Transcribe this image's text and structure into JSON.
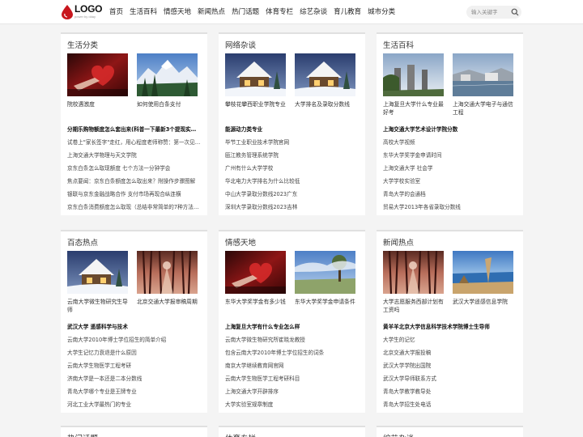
{
  "logo": {
    "text": "LOGO",
    "sub": "power by dday"
  },
  "nav": [
    "首页",
    "生活百科",
    "情感天地",
    "新闻热点",
    "热门话题",
    "体育专栏",
    "综艺杂谈",
    "育儿教育",
    "城市分类"
  ],
  "search": {
    "placeholder": "输入关键字"
  },
  "sections": [
    {
      "title": "生活分类",
      "thumbs": [
        {
          "image": "heart",
          "caption": "院校遇激度"
        },
        {
          "image": "mountain",
          "caption": "如何使用白条支付"
        }
      ],
      "items": [
        "分期乐购物额度怎么套出来(科普一下最新3个提现实…",
        "试卷上\"家长签字\"走红，用心程度老师称赞：第一次见…",
        "上海交通大学物理与天文学院",
        "京东白条怎么取现额度 七个方法一分钟学会",
        "焦点要闻：京东白条额度怎么取出来？附操作步骤图解",
        "银联与京东金融战略合作 支付市场再现合纵连横",
        "京东白条消费额度怎么取现（总结非常简单的7种方法…"
      ]
    },
    {
      "title": "网络杂谈",
      "thumbs": [
        {
          "image": "snowhouse",
          "caption": "攀枝花攀西职业学院专业"
        },
        {
          "image": "snowhouse",
          "caption": "大学排名及录取分数线"
        }
      ],
      "items": [
        "能源动力类专业",
        "毕节工业职业技术学院官网",
        "瓯江教务管理系统学院",
        "广州有什么大学学校",
        "华北电力大学排名为什么比较低",
        "中山大学录取分数线2023广东",
        "深圳大学录取分数线2023吉林"
      ]
    },
    {
      "title": "生活百科",
      "thumbs": [
        {
          "image": "ruins",
          "caption": "上海复旦大学什么专业最好考"
        },
        {
          "image": "lake",
          "caption": "上海交通大学电子与通信工程"
        }
      ],
      "items": [
        "上海交通大学艺术设计学院分数",
        "高校大学视频",
        "东华大学奖学金申请时间",
        "上海交通大学 社会学",
        "大学学校实验室",
        "青岛大学的会通档",
        "贸易大学2013年各省录取分数线"
      ]
    },
    {
      "title": "百态热点",
      "thumbs": [
        {
          "image": "snowhouse",
          "caption": "云南大学微生物研究生导师"
        },
        {
          "image": "forest",
          "caption": "北京交通大学报审稿周期"
        }
      ],
      "items": [
        "武汉大学 遥感科学与技术",
        "云南大学2010年博士学位招生的简单介绍",
        "大学生记忆力衰退是什么原因",
        "云南大学生物医学工程考研",
        "济南大学是一本还是二本分数线",
        "青岛大学哪个专业是王牌专业",
        "河北工业大学最热门的专业"
      ]
    },
    {
      "title": "情感天地",
      "thumbs": [
        {
          "image": "heart",
          "caption": "东华大学奖学金有多少钱"
        },
        {
          "image": "tree",
          "caption": "东华大学奖学金申请条件"
        }
      ],
      "items": [
        "上海复旦大学有什么专业怎么样",
        "云南大学微生物研究所崔晓龙教授",
        "包含云南大学2010年博士学位招生的词条",
        "南京大学继续教育网官网",
        "云南大学生物医学工程考研科目",
        "上海交通大学开辟排序",
        "大学实验室规章制度"
      ]
    },
    {
      "title": "新闻热点",
      "thumbs": [
        {
          "image": "forest",
          "caption": "大学志愿服务西部计划有工资吗"
        },
        {
          "image": "coast",
          "caption": "武汉大学遥感信息学院"
        }
      ],
      "items": [
        "黄羊羊北京大学信息科学技术学院博士生导师",
        "大学生的记忆",
        "北京交通大学报投稿",
        "武汉大学学院出国院",
        "武汉大学导师联系方式",
        "青岛大学教学教导处",
        "青岛大学招生处电话"
      ]
    },
    {
      "title": "热门话题"
    },
    {
      "title": "体育专栏"
    },
    {
      "title": "综艺杂谈"
    }
  ]
}
